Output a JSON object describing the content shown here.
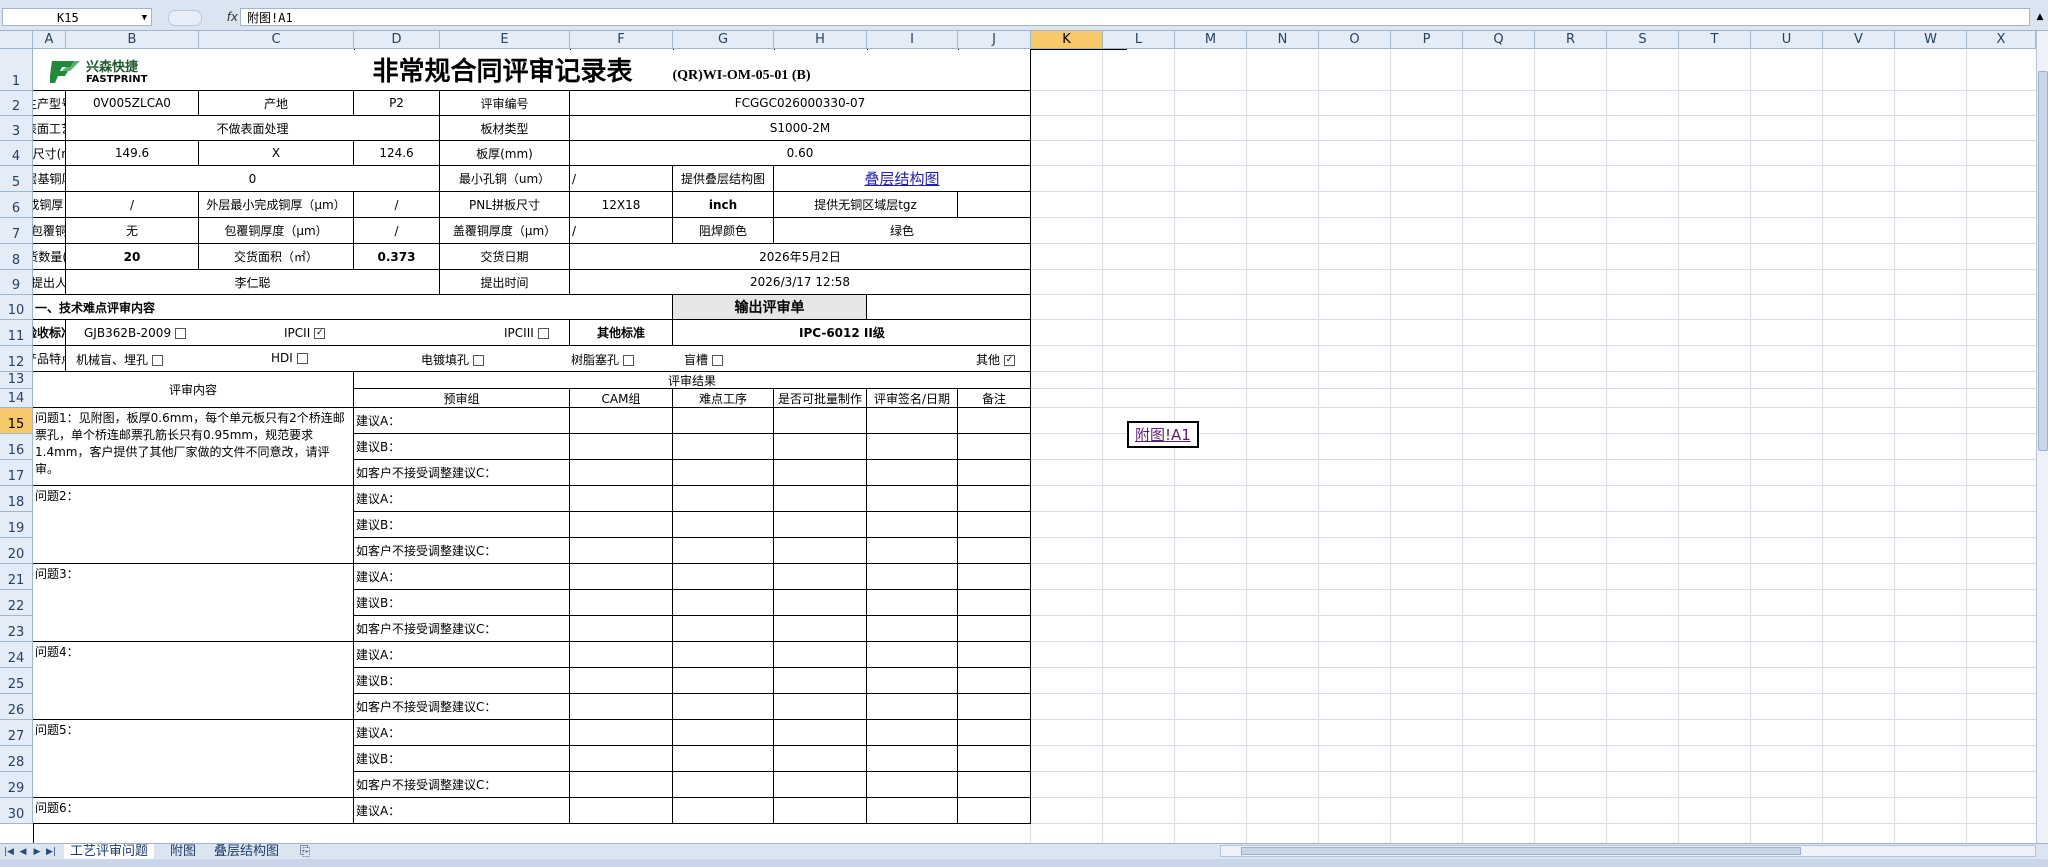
{
  "formula_bar": {
    "name_box": "K15",
    "fx": "fx",
    "formula": "附图!A1"
  },
  "columns": [
    "A",
    "B",
    "C",
    "D",
    "E",
    "F",
    "G",
    "H",
    "I",
    "J",
    "K",
    "L",
    "M",
    "N",
    "O",
    "P",
    "Q",
    "R",
    "S",
    "T",
    "U",
    "V",
    "W",
    "X"
  ],
  "selected_column": "K",
  "rows": [
    "1",
    "2",
    "3",
    "4",
    "5",
    "6",
    "7",
    "8",
    "9",
    "10",
    "11",
    "12",
    "13",
    "14",
    "15",
    "16",
    "17",
    "18",
    "19",
    "20",
    "21",
    "22",
    "23",
    "24",
    "25",
    "26",
    "27",
    "28",
    "29",
    "30"
  ],
  "selected_row": "15",
  "logo": {
    "brand": "兴森快捷",
    "brand_en": "FASTPRINT"
  },
  "form": {
    "title": "非常规合同评审记录表",
    "code": "(QR)WI-OM-05-01 (B)",
    "labels": {
      "prod_model": "生产型号",
      "origin": "产地",
      "review_no": "评审编号",
      "surface": "表面工艺",
      "board_type": "板材类型",
      "size": "成品尺寸(mm)",
      "thickness": "板厚(mm)",
      "base_cu": "内/外层基铜厚(OZ)",
      "min_hole": "最小孔铜（um）",
      "stackup_provide": "提供叠层结构图",
      "outer_cu": "外层完成铜厚（μm）",
      "outer_min_cu": "外层最小完成铜厚（μm）",
      "pnl_size": "PNL拼板尺寸",
      "no_cu_area": "提供无铜区域层tgz",
      "wrap_req": "有无包覆铜要求",
      "wrap_thk": "包覆铜厚度（μm）",
      "cap_thk": "盖覆铜厚度（μm）",
      "mask_color": "阻焊颜色",
      "qty": "交货数量(块)",
      "area": "交货面积（㎡）",
      "delivery": "交货日期",
      "proposer": "提出人",
      "proposed_time": "提出时间"
    },
    "values": {
      "prod_model": "0V005ZLCA0",
      "origin": "P2",
      "review_no": "FCGGC026000330-07",
      "surface": "不做表面处理",
      "board_type": "S1000-2M",
      "size_x": "149.6",
      "size_sep": "X",
      "size_y": "124.6",
      "thickness": "0.60",
      "base_cu": "0",
      "min_hole": "/",
      "stackup_link": "叠层结构图",
      "outer_cu": "/",
      "outer_min_cu": "/",
      "pnl_size": "12X18",
      "pnl_unit": "inch",
      "wrap_req": "无",
      "wrap_thk": "/",
      "cap_thk": "/",
      "mask_color": "绿色",
      "qty": "20",
      "area": "0.373",
      "delivery": "2026年5月2日",
      "proposer": "李仁聪",
      "proposed_time": "2026/3/17 12:58"
    },
    "section1": "一、技术难点评审内容",
    "output_btn": "输出评审单",
    "accept_std": "验收标准",
    "std_options": [
      "GJB362B-2009",
      "IPCII",
      "IPCIII"
    ],
    "std_checked": [
      false,
      true,
      false
    ],
    "other_std_label": "其他标准",
    "other_std_value": "IPC-6012 II级",
    "features_label": "产品特点",
    "features": [
      "机械盲、埋孔",
      "HDI",
      "电镀填孔",
      "树脂塞孔",
      "盲槽",
      "其他"
    ],
    "features_checked": [
      false,
      false,
      false,
      false,
      false,
      true
    ],
    "review_content": "评审内容",
    "review_result": "评审结果",
    "result_cols": [
      "预审组",
      "CAM组",
      "难点工序",
      "是否可批量制作",
      "评审签名/日期",
      "备注"
    ],
    "issues": [
      {
        "title": "问题1：见附图，板厚0.6mm，每个单元板只有2个桥连邮票孔，单个桥连邮票孔筋长只有0.95mm，规范要求1.4mm，客户提供了其他厂家做的文件不同意改，请评审。"
      },
      {
        "title": "问题2："
      },
      {
        "title": "问题3："
      },
      {
        "title": "问题4："
      },
      {
        "title": "问题5："
      },
      {
        "title": "问题6："
      }
    ],
    "suggestions": [
      "建议A：",
      "建议B：",
      "如客户不接受调整建议C："
    ]
  },
  "selected_cell_value": "附图!A1",
  "sheet_tabs": [
    "工艺评审问题",
    "附图",
    "叠层结构图"
  ]
}
